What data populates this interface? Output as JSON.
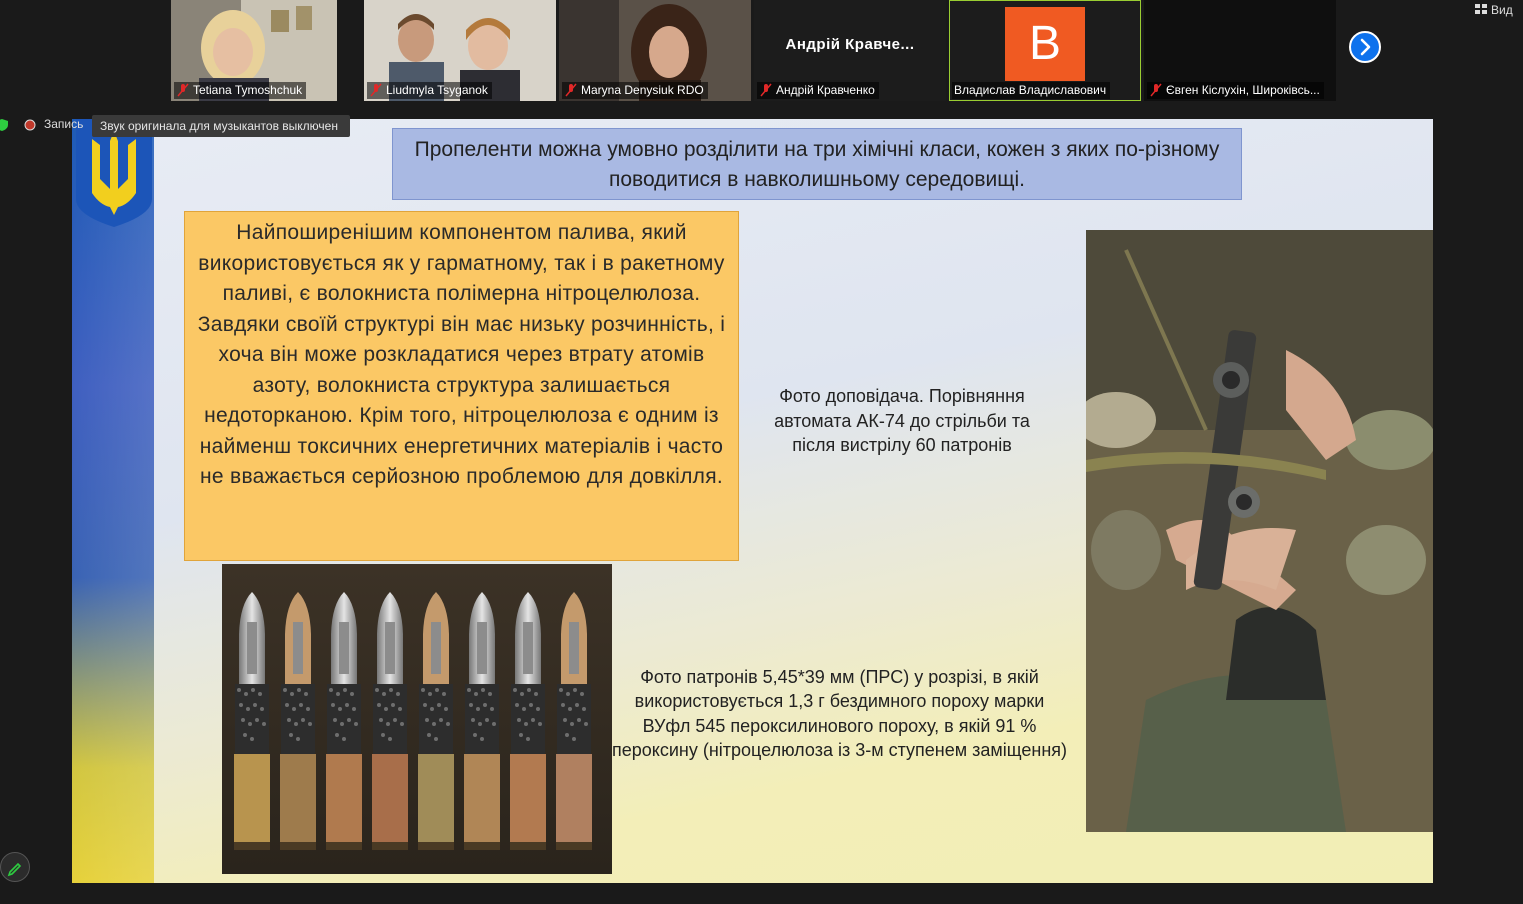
{
  "participants": [
    {
      "name": "Tetiana Tymoshchuk",
      "muted": true
    },
    {
      "name": "Liudmyla Tsyganok",
      "muted": true
    },
    {
      "name": "Maryna Denysiuk RDO",
      "muted": true
    },
    {
      "name": "Андрій Кравченко",
      "display_name": "Андрій Кравче...",
      "muted": true
    },
    {
      "name": "Владислав Владиславович",
      "avatar_letter": "B",
      "active": true
    },
    {
      "name": "Євген Кіслухін, Широківсь...",
      "muted": true
    }
  ],
  "toolbar": {
    "view_label": "Вид",
    "next_icon": "chevron-right-icon"
  },
  "recording": {
    "label": "Запись",
    "toast": "Звук оригинала для музыкантов выключен"
  },
  "slide": {
    "title": "Пропеленти можна умовно розділити на три хімічні класи, кожен з яких по-різному поводитися в навколишньому середовищі.",
    "body": "Найпоширенішим компонентом палива, який використовується як у гарматному, так і в ракетному паливі, є волокниста полімерна нітроцелюлоза. Завдяки своїй структурі він має низьку розчинність, і хоча він може розкладатися через втрату атомів азоту, волокниста структура залишається недоторканою. Крім того, нітроцелюлоза є одним із найменш токсичних енергетичних матеріалів і часто не вважається серйозною проблемою для довкілля.",
    "caption_rifle": "Фото доповідача. Порівняння автомата АК-74 до стрільби та після вистрілу 60 патронів",
    "caption_ammo": "Фото патронів 5,45*39 мм (ПРС) у розрізі, в якій використовується 1,3 г  бездимного пороху марки ВУфл 545 пероксилинового пороху, в якій 91 % пероксину (нітроцелюлоза із 3-м ступенем заміщення)"
  },
  "colors": {
    "brand_orange": "#f05a22",
    "zoom_blue": "#0e72ed",
    "active_outline": "#9acd32"
  }
}
